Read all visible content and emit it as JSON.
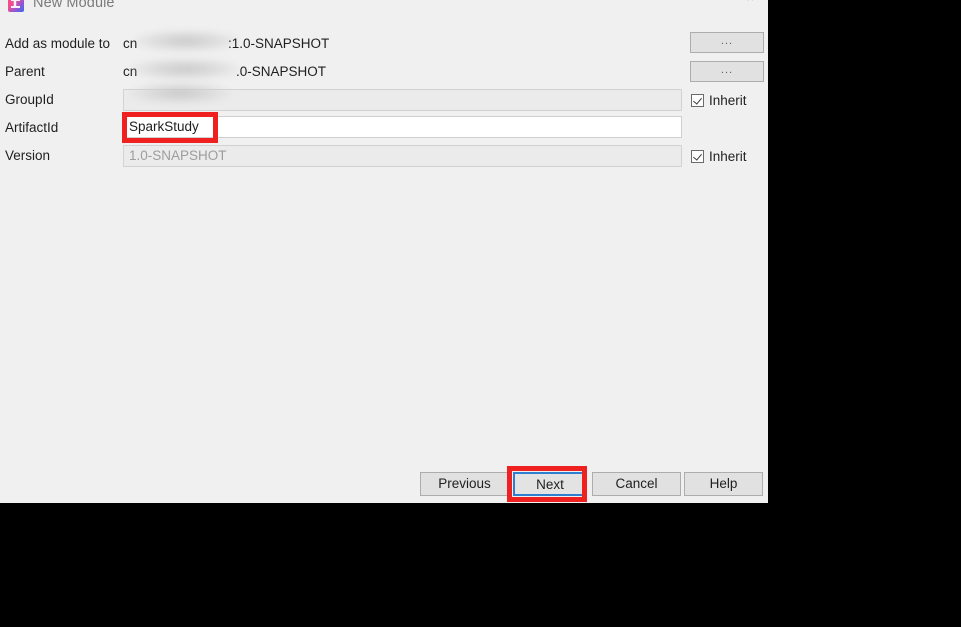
{
  "window": {
    "title": "New Module",
    "app_icon": "intellij-idea-icon",
    "close_label": "×"
  },
  "form": {
    "rows": [
      {
        "label": "Add as module to",
        "kind": "text",
        "prefix": "cn",
        "redacted": true,
        "suffix": ":1.0-SNAPSHOT",
        "button": "..."
      },
      {
        "label": "Parent",
        "kind": "text",
        "prefix": "cn",
        "redacted": true,
        "suffix": ".0-SNAPSHOT",
        "button": "..."
      },
      {
        "label": "GroupId",
        "kind": "field",
        "value": "",
        "enabled": false,
        "redacted": true,
        "inherit_label": "Inherit",
        "inherit_checked": true
      },
      {
        "label": "ArtifactId",
        "kind": "field",
        "value": "SparkStudy",
        "enabled": true,
        "redacted": false,
        "highlighted": true
      },
      {
        "label": "Version",
        "kind": "field",
        "value": "1.0-SNAPSHOT",
        "enabled": false,
        "redacted": false,
        "inherit_label": "Inherit",
        "inherit_checked": true
      }
    ]
  },
  "buttons": {
    "previous": "Previous",
    "next": "Next",
    "cancel": "Cancel",
    "help": "Help"
  },
  "annotations": {
    "color": "#ee2020",
    "targets": [
      "artifactid-field",
      "next-button"
    ]
  },
  "colors": {
    "dialog_background": "#f0f0f0",
    "desktop_background": "#000000",
    "focus_border": "#2f7fd1",
    "annotation_red": "#ee2020",
    "disabled_field": "#ebebeb",
    "enabled_field": "#ffffff"
  }
}
